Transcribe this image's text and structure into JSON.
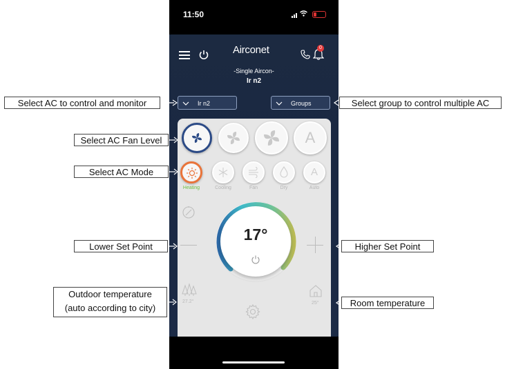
{
  "status_bar": {
    "time": "11:50"
  },
  "header": {
    "logo": "Airconet",
    "notification_count": "0",
    "subtitle": "-Single Aircon-",
    "unit_name": "Ir n2"
  },
  "selectors": {
    "ac_select": "Ir n2",
    "group_select": "Groups"
  },
  "fan_levels": [
    {
      "icon": "fan-low-icon",
      "active": true
    },
    {
      "icon": "fan-medium-icon",
      "active": false
    },
    {
      "icon": "fan-high-icon",
      "active": false
    },
    {
      "icon": "fan-auto-icon",
      "label": "A",
      "active": false
    }
  ],
  "modes": [
    {
      "label": "Heating",
      "icon": "sun-icon",
      "active": true
    },
    {
      "label": "Cooling",
      "icon": "snowflake-icon",
      "active": false
    },
    {
      "label": "Fan",
      "icon": "fan-mode-icon",
      "active": false
    },
    {
      "label": "Dry",
      "icon": "droplet-icon",
      "active": false
    },
    {
      "label": "Auto",
      "icon": "auto-icon",
      "glyph": "A",
      "active": false
    }
  ],
  "thermostat": {
    "set_point": "17°",
    "outdoor_temp": "27.2°",
    "room_temp": "25°"
  },
  "colors": {
    "app_bg": "#1c2a41",
    "heating_accent": "#e9743a",
    "active_label": "#6dbf3f",
    "fan_active_ring": "#2b4a86"
  },
  "callouts": {
    "select_ac": "Select AC to control and monitor",
    "select_group": "Select group to control multiple AC",
    "fan_level": "Select AC Fan Level",
    "mode": "Select AC Mode",
    "lower_set_point": "Lower Set Point",
    "higher_set_point": "Higher Set Point",
    "outdoor_line1": "Outdoor temperature",
    "outdoor_line2": "(auto according to city)",
    "room_temp": "Room temperature"
  }
}
